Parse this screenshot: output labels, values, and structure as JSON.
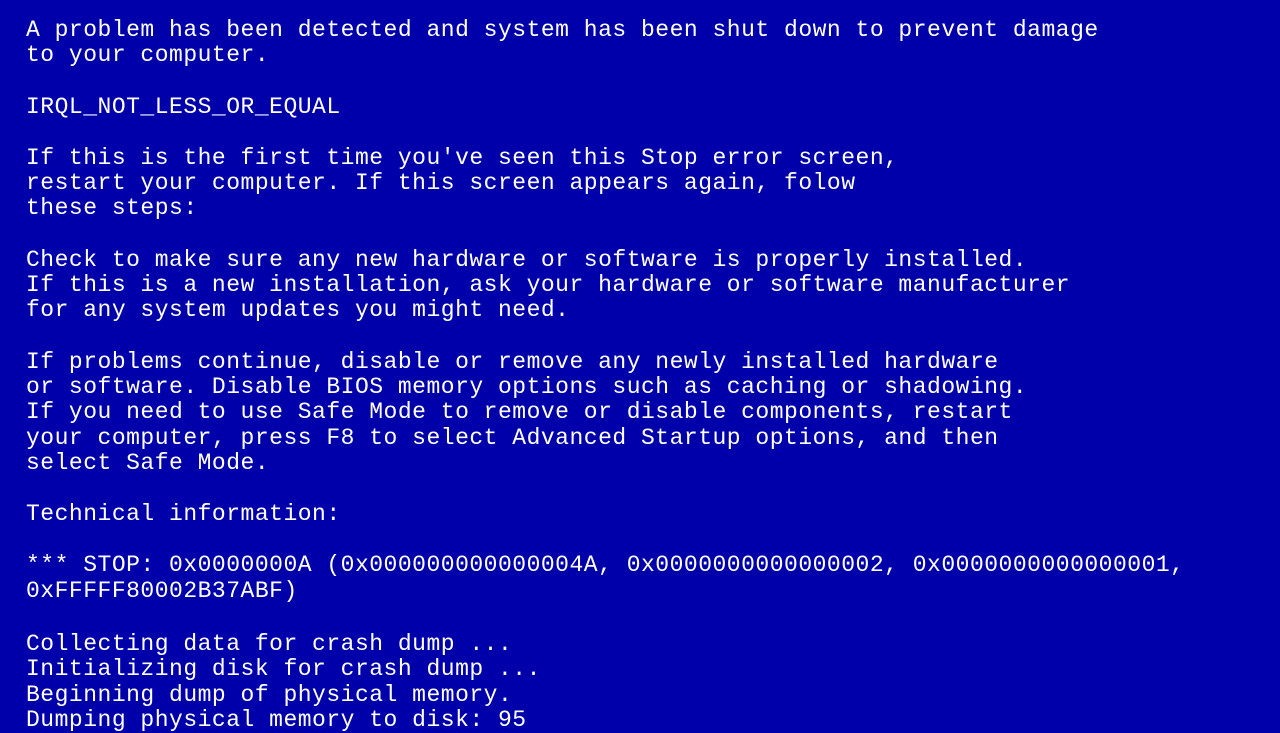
{
  "bsod": {
    "intro": "A problem has been detected and system has been shut down to prevent damage\nto your computer.",
    "error_code": "IRQL_NOT_LESS_OR_EQUAL",
    "first_time": "If this is the first time you've seen this Stop error screen,\nrestart your computer. If this screen appears again, folow\nthese steps:",
    "check_hardware": "Check to make sure any new hardware or software is properly installed.\nIf this is a new installation, ask your hardware or software manufacturer\nfor any system updates you might need.",
    "if_continue": "If problems continue, disable or remove any newly installed hardware\nor software. Disable BIOS memory options such as caching or shadowing.\nIf you need to use Safe Mode to remove or disable components, restart\nyour computer, press F8 to select Advanced Startup options, and then\nselect Safe Mode.",
    "tech_info_label": "Technical information:",
    "stop_line": "*** STOP: 0x0000000A (0x000000000000004A, 0x0000000000000002, 0x0000000000000001,\n0xFFFFF80002B37ABF)",
    "dump_collecting": "Collecting data for crash dump ...",
    "dump_init": "Initializing disk for crash dump ...",
    "dump_begin": "Beginning dump of physical memory.",
    "dump_progress": "Dumping physical memory to disk: 95"
  }
}
